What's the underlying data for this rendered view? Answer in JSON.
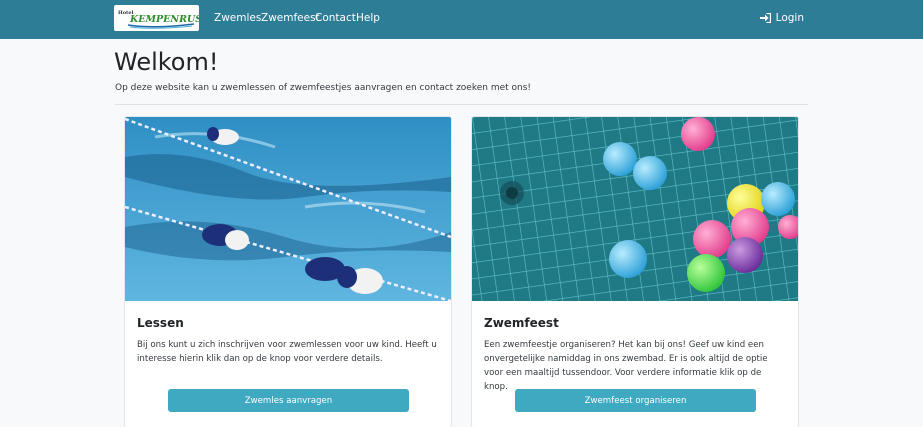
{
  "navbar": {
    "brand_small": "Hotel",
    "brand_name": "KEMPENRUST",
    "links": [
      {
        "label": "Zwemles"
      },
      {
        "label": "Zwemfeest"
      },
      {
        "label": "Contact"
      },
      {
        "label": "Help"
      }
    ],
    "login_label": "Login",
    "login_icon": "sign-in-icon",
    "bg_color": "#2e7d96"
  },
  "main": {
    "title": "Welkom!",
    "lead": "Op deze website kan u zwemlessen of zwemfeestjes aanvragen en contact zoeken met ons!"
  },
  "cards": [
    {
      "title": "Lessen",
      "text": "Bij ons kunt u zich inschrijven voor zwemlessen voor uw kind. Heeft u interesse hierin klik dan op de knop voor verdere details.",
      "button": "Zwemles aanvragen"
    },
    {
      "title": "Zwemfeest",
      "text": "Een zwemfeestje organiseren? Het kan bij ons! Geef uw kind een onvergetelijke namiddag in ons zwembad. Er is ook altijd de optie voor een maaltijd tussendoor. Voor verdere informatie klik op de knop.",
      "button": "Zwemfeest organiseren"
    }
  ],
  "colors": {
    "accent_button": "#3ea9c1",
    "background": "#f8f9fa"
  }
}
